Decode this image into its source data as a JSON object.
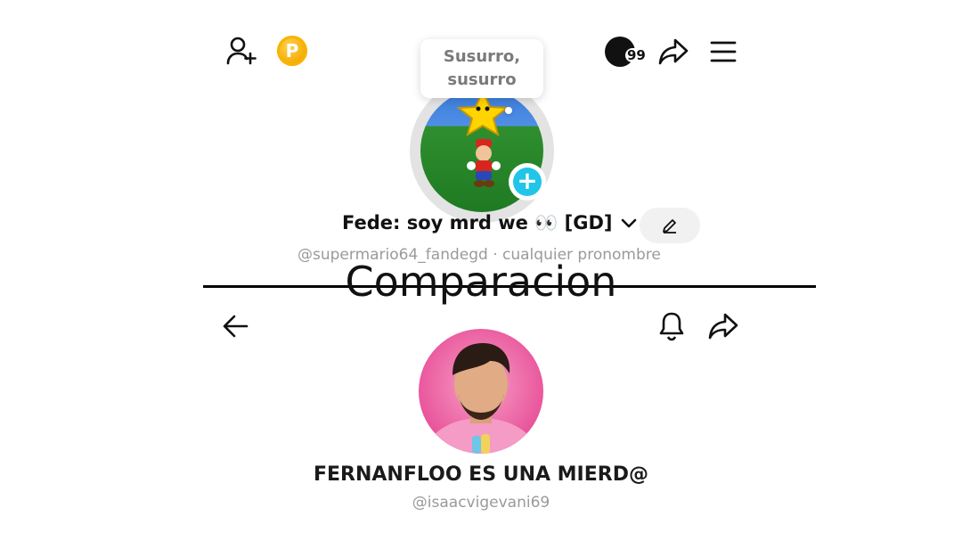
{
  "top_profile": {
    "points_badge_letter": "P",
    "notification_count": "99",
    "status_bubble": {
      "line1": "Susurro,",
      "line2": "susurro"
    },
    "display_name": "Fede: soy mrd we 👀 [GD]",
    "handle_line": "@supermario64_fandegd · cualquier pronombre",
    "add_symbol": "+"
  },
  "caption": "Comparacion",
  "bottom_profile": {
    "display_name": "FERNANFLOO ES UNA MIERD@",
    "handle": "@isaacvigevani69"
  },
  "colors": {
    "accent_cyan": "#20c5e8",
    "coin": "#f2a900",
    "muted_text": "#9a9a9a"
  }
}
